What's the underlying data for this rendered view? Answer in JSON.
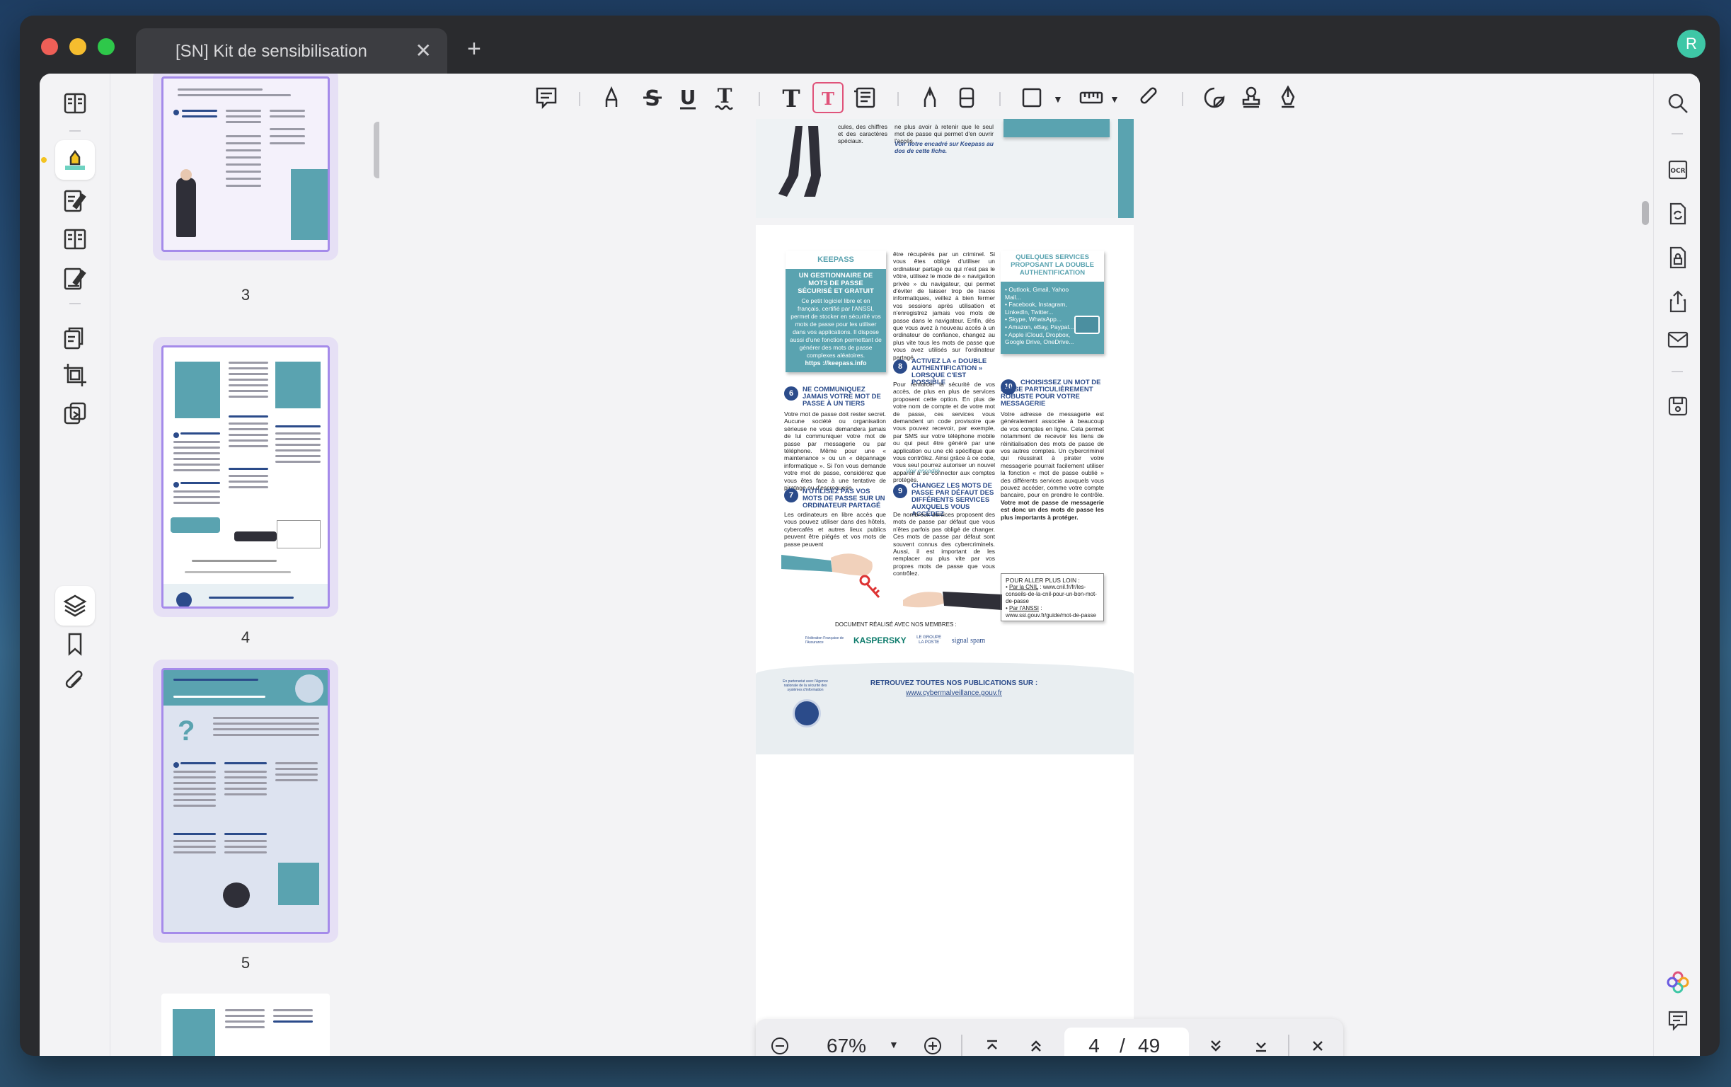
{
  "window": {
    "tab_title": "[SN] Kit de sensibilisation",
    "avatar_initial": "R"
  },
  "thumbnails": [
    {
      "label": "3"
    },
    {
      "label": "4"
    },
    {
      "label": "5"
    }
  ],
  "document": {
    "top_fragment": {
      "col1": "cules, des chiffres et des caractères spéciaux.",
      "col2_a": "ne plus avoir à retenir que le seul mot de passe qui permet d'en ouvrir l'accès.",
      "col2_b": "Voir notre encadré sur Keepass au dos de cette fiche."
    },
    "keepass": {
      "title": "KEEPASS",
      "subtitle": "UN GESTIONNAIRE DE MOTS DE PASSE SÉCURISÉ ET GRATUIT",
      "body": "Ce petit logiciel libre et en français, certifié par l'ANSSI, permet de stocker en sécurité vos mots de passe pour les utiliser dans vos applications. Il dispose aussi d'une fonction permettant de générer des mots de passe complexes aléatoires.",
      "link": "https ://keepass.info"
    },
    "col2_intro": "être récupérés par un criminel. Si vous êtes obligé d'utiliser un ordinateur partagé ou qui n'est pas le vôtre, utilisez le mode de « navigation privée » du navigateur, qui permet d'éviter de laisser trop de traces informatiques, veillez à bien fermer vos sessions après utilisation et n'enregistrez jamais vos mots de passe dans le navigateur. Enfin, dès que vous avez à nouveau accès à un ordinateur de confiance, changez au plus vite tous les mots de passe que vous avez utilisés sur l'ordinateur partagé.",
    "services_box": {
      "title": "QUELQUES SERVICES PROPOSANT LA DOUBLE AUTHENTIFICATION",
      "items": [
        "Outlook, Gmail, Yahoo Mail...",
        "Facebook, Instagram, LinkedIn, Twitter...",
        "Skype, WhatsApp...",
        "Amazon, eBay, Paypal...",
        "Apple iCloud, Dropbox, Google Drive, OneDrive..."
      ]
    },
    "s6": {
      "num": "6",
      "title": "NE COMMUNIQUEZ JAMAIS VOTRE MOT DE PASSE À UN TIERS",
      "body": "Votre mot de passe doit rester secret. Aucune société ou organisation sérieuse ne vous demandera jamais de lui communiquer votre mot de passe par messagerie ou par téléphone. Même pour une « maintenance » ou un « dépannage informatique ». Si l'on vous demande votre mot de passe, considérez que vous êtes face à une tentative de piratage ou d'escroquerie."
    },
    "s7": {
      "num": "7",
      "title": "N'UTILISEZ PAS VOS MOTS DE PASSE SUR UN ORDINATEUR PARTAGÉ",
      "body": "Les ordinateurs en libre accès que vous pouvez utiliser dans des hôtels, cybercafés et autres lieux publics peuvent être piégés et vos mots de passe peuvent"
    },
    "s8": {
      "num": "8",
      "title": "ACTIVEZ LA « DOUBLE AUTHENTIFICATION » LORSQUE C'EST POSSIBLE",
      "body": "Pour renforcer la sécurité de vos accès, de plus en plus de services proposent cette option. En plus de votre nom de compte et de votre mot de passe, ces services vous demandent un code provisoire que vous pouvez recevoir, par exemple, par SMS sur votre téléphone mobile ou qui peut être généré par une application ou une clé spécifique que vous contrôlez. Ainsi grâce à ce code, vous seul pourrez autoriser un nouvel appareil à se connecter aux comptes protégés.",
      "link": "Voir encadré."
    },
    "s9": {
      "num": "9",
      "title": "CHANGEZ LES MOTS DE PASSE PAR DÉFAUT DES DIFFÉRENTS SERVICES AUXQUELS VOUS ACCÉDEZ",
      "body": "De nombreux services proposent des mots de passe par défaut que vous n'êtes parfois pas obligé de changer. Ces mots de passe par défaut sont souvent connus des cybercriminels. Aussi, il est important de les remplacer au plus vite par vos propres mots de passe que vous contrôlez."
    },
    "s10": {
      "num": "10",
      "title": "CHOISISSEZ UN MOT DE PASSE PARTICULIÈREMENT ROBUSTE POUR VOTRE MESSAGERIE",
      "body": "Votre adresse de messagerie est généralement associée à beaucoup de vos comptes en ligne. Cela permet notamment de recevoir les liens de réinitialisation des mots de passe de vos autres comptes. Un cybercriminel qui réussirait à pirater votre messagerie pourrait facilement utiliser la fonction « mot de passe oublié » des différents services auxquels vous pouvez accéder, comme votre compte bancaire, pour en prendre le contrôle.",
      "bold": "Votre mot de passe de messagerie est donc un des mots de passe les plus importants à protéger."
    },
    "further": {
      "title": "POUR ALLER PLUS LOIN :",
      "cnil_label": "Par la CNIL",
      "cnil_url": ": www.cnil.fr/fr/les-conseils-de-la-cnil-pour-un-bon-mot-de-passe",
      "anssi_label": "Par l'ANSSI",
      "anssi_url": ": www.ssi.gouv.fr/guide/mot-de-passe"
    },
    "members_label": "DOCUMENT RÉALISÉ AVEC NOS MEMBRES :",
    "logos": [
      "Fédération Française de l'Assurance",
      "KASPERSKY",
      "LE GROUPE LA POSTE",
      "signal spam"
    ],
    "footer": {
      "partner": "En partenariat avec l'Agence nationale de la sécurité des systèmes d'information",
      "title": "RETROUVEZ TOUTES NOS PUBLICATIONS SUR :",
      "url": "www.cybermalveillance.gouv.fr"
    }
  },
  "navbar": {
    "zoom": "67%",
    "current_page": "4",
    "separator": "/",
    "total_pages": "49"
  },
  "colors": {
    "accent_teal": "#5aa3b0",
    "accent_blue": "#2b4b8a",
    "active_tool": "#e0537a",
    "thumb_border": "#a58bea"
  }
}
